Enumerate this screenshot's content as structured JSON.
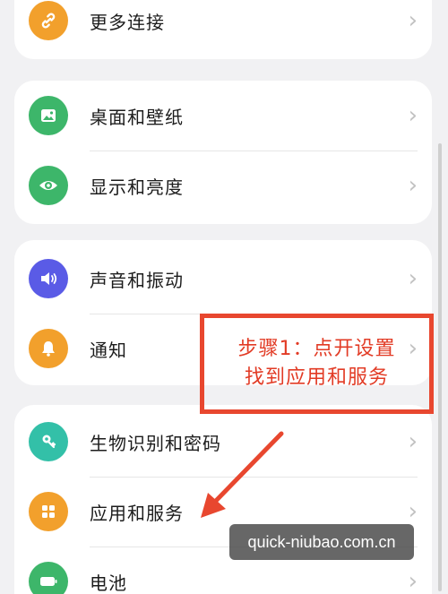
{
  "settings": {
    "groups": [
      {
        "items": [
          {
            "label": "更多连接",
            "icon": "link-icon",
            "color": "#f2a02c"
          }
        ]
      },
      {
        "items": [
          {
            "label": "桌面和壁纸",
            "icon": "wallpaper-icon",
            "color": "#3db66a"
          },
          {
            "label": "显示和亮度",
            "icon": "eye-icon",
            "color": "#3db66a"
          }
        ]
      },
      {
        "items": [
          {
            "label": "声音和振动",
            "icon": "speaker-icon",
            "color": "#5a5be6"
          },
          {
            "label": "通知",
            "icon": "bell-icon",
            "color": "#f2a02c"
          }
        ]
      },
      {
        "items": [
          {
            "label": "生物识别和密码",
            "icon": "key-icon",
            "color": "#33c0a8"
          },
          {
            "label": "应用和服务",
            "icon": "apps-icon",
            "color": "#f2a02c"
          },
          {
            "label": "电池",
            "icon": "battery-icon",
            "color": "#3db66a"
          }
        ]
      }
    ]
  },
  "annotation": {
    "line1": "步骤1：点开设置",
    "line2": "找到应用和服务",
    "color": "#e23b25"
  },
  "watermark": {
    "text": "quick-niubao.com.cn"
  }
}
